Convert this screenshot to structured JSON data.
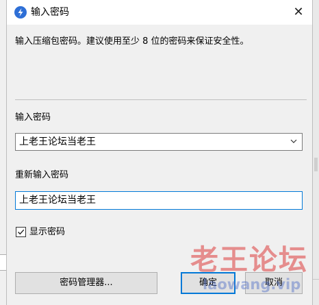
{
  "dialog": {
    "title": "输入密码",
    "close_glyph": "✕",
    "instruction": "输入压缩包密码。建议使用至少 8 位的密码来保证安全性。",
    "password_label": "输入密码",
    "password_value": "上老王论坛当老王",
    "reenter_label": "重新输入密码",
    "reenter_value": "上老王论坛当老王",
    "show_password_label": "显示密码",
    "show_password_checked": true,
    "buttons": {
      "manager": "密码管理器...",
      "ok": "确定",
      "cancel": "取消"
    }
  },
  "watermark": {
    "text": "老王论坛",
    "url": "laowang.vip"
  },
  "colors": {
    "focus_border": "#0078d7",
    "app_icon": "#2e6fd6"
  }
}
